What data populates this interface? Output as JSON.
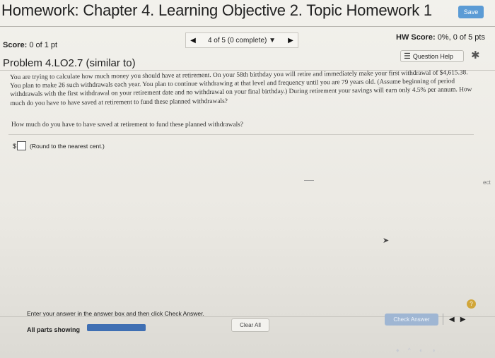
{
  "header": {
    "title": "Homework: Chapter 4. Learning Objective 2. Topic Homework 1",
    "save_label": "Save"
  },
  "status": {
    "score_label": "Score:",
    "score_value": "0 of 1 pt",
    "nav_label": "4 of 5 (0 complete)",
    "hw_score_label": "HW Score:",
    "hw_score_value": "0%, 0 of 5 pts"
  },
  "problem": {
    "title": "Problem 4.LO2.7 (similar to)",
    "question_help_label": "Question Help",
    "text": "You are trying to calculate how much money you should have at retirement. On your 58th birthday you will retire and immediately make your first withdrawal of $4,615.38. You plan to make 26 such withdrawals each year. You plan to continue withdrawing at that level and frequency until you are 79 years old. (Assume beginning of period withdrawals with the first withdrawal on your retirement date and no withdrawal on your final birthday.) During retirement your savings will earn only 4.5% per annum. How much do you have to have saved at retirement to fund these planned withdrawals?",
    "ask": "How much do you have to have saved at retirement to fund these planned withdrawals?",
    "currency_symbol": "$",
    "answer_hint": "(Round to the nearest cent.)",
    "side_fragment": "ect"
  },
  "footer": {
    "instruction": "Enter your answer in the answer box and then click Check Answer.",
    "all_parts_label": "All parts showing",
    "progress_fraction": 1.0,
    "clear_all_label": "Clear All",
    "check_answer_label": "Check Answer",
    "help_glyph": "?"
  },
  "colors": {
    "accent": "#5b9bd5",
    "progress_fill": "#3f6fb3",
    "check_btn": "#9fb6d3",
    "help_circle": "#d1a63a"
  }
}
